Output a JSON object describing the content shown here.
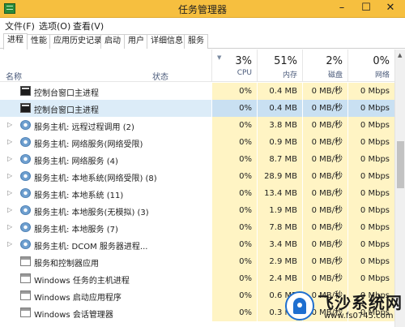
{
  "window": {
    "title": "任务管理器",
    "minimize": "–",
    "maximize": "☐",
    "close": "✕"
  },
  "menu": [
    "文件(F)",
    "选项(O)",
    "查看(V)"
  ],
  "tabs": [
    {
      "label": "进程",
      "active": true
    },
    {
      "label": "性能"
    },
    {
      "label": "应用历史记录"
    },
    {
      "label": "启动"
    },
    {
      "label": "用户"
    },
    {
      "label": "详细信息"
    },
    {
      "label": "服务"
    }
  ],
  "columns": {
    "name": "名称",
    "status": "状态",
    "cpu": {
      "pct": "3%",
      "label": "CPU"
    },
    "memory": {
      "pct": "51%",
      "label": "内存"
    },
    "disk": {
      "pct": "2%",
      "label": "磁盘"
    },
    "network": {
      "pct": "0%",
      "label": "网络"
    }
  },
  "processes": [
    {
      "name": "控制台窗口主进程",
      "icon": "console-icon",
      "expandable": false,
      "cpu": "0%",
      "memory": "0.4 MB",
      "disk": "0 MB/秒",
      "network": "0 Mbps"
    },
    {
      "name": "控制台窗口主进程",
      "icon": "console-icon",
      "expandable": false,
      "selected": true,
      "cpu": "0%",
      "memory": "0.4 MB",
      "disk": "0 MB/秒",
      "network": "0 Mbps"
    },
    {
      "name": "服务主机: 远程过程调用 (2)",
      "icon": "gear-icon",
      "expandable": true,
      "cpu": "0%",
      "memory": "3.8 MB",
      "disk": "0 MB/秒",
      "network": "0 Mbps"
    },
    {
      "name": "服务主机: 网络服务(网络受限)",
      "icon": "gear-icon",
      "expandable": true,
      "cpu": "0%",
      "memory": "0.9 MB",
      "disk": "0 MB/秒",
      "network": "0 Mbps"
    },
    {
      "name": "服务主机: 网络服务 (4)",
      "icon": "gear-icon",
      "expandable": true,
      "cpu": "0%",
      "memory": "8.7 MB",
      "disk": "0 MB/秒",
      "network": "0 Mbps"
    },
    {
      "name": "服务主机: 本地系统(网络受限) (8)",
      "icon": "gear-icon",
      "expandable": true,
      "cpu": "0%",
      "memory": "28.9 MB",
      "disk": "0 MB/秒",
      "network": "0 Mbps"
    },
    {
      "name": "服务主机: 本地系统 (11)",
      "icon": "gear-icon",
      "expandable": true,
      "cpu": "0%",
      "memory": "13.4 MB",
      "disk": "0 MB/秒",
      "network": "0 Mbps"
    },
    {
      "name": "服务主机: 本地服务(无模拟) (3)",
      "icon": "gear-icon",
      "expandable": true,
      "cpu": "0%",
      "memory": "1.9 MB",
      "disk": "0 MB/秒",
      "network": "0 Mbps"
    },
    {
      "name": "服务主机: 本地服务 (7)",
      "icon": "gear-icon",
      "expandable": true,
      "cpu": "0%",
      "memory": "7.8 MB",
      "disk": "0 MB/秒",
      "network": "0 Mbps"
    },
    {
      "name": "服务主机: DCOM 服务器进程...",
      "icon": "gear-icon",
      "expandable": true,
      "cpu": "0%",
      "memory": "3.4 MB",
      "disk": "0 MB/秒",
      "network": "0 Mbps"
    },
    {
      "name": "服务和控制器应用",
      "icon": "app-icon",
      "expandable": false,
      "cpu": "0%",
      "memory": "2.9 MB",
      "disk": "0 MB/秒",
      "network": "0 Mbps"
    },
    {
      "name": "Windows 任务的主机进程",
      "icon": "app-icon",
      "expandable": false,
      "cpu": "0%",
      "memory": "2.4 MB",
      "disk": "0 MB/秒",
      "network": "0 Mbps"
    },
    {
      "name": "Windows 启动应用程序",
      "icon": "app-icon",
      "expandable": false,
      "cpu": "0%",
      "memory": "0.6 MB",
      "disk": "0 MB/秒",
      "network": "0 Mbps"
    },
    {
      "name": "Windows 会话管理器",
      "icon": "app-icon",
      "expandable": false,
      "cpu": "0%",
      "memory": "0.3 MB",
      "disk": "0 MB/秒",
      "network": "0 Mbps"
    }
  ],
  "watermark": {
    "name": "飞沙系统网",
    "url": "www.fs0745.com"
  }
}
